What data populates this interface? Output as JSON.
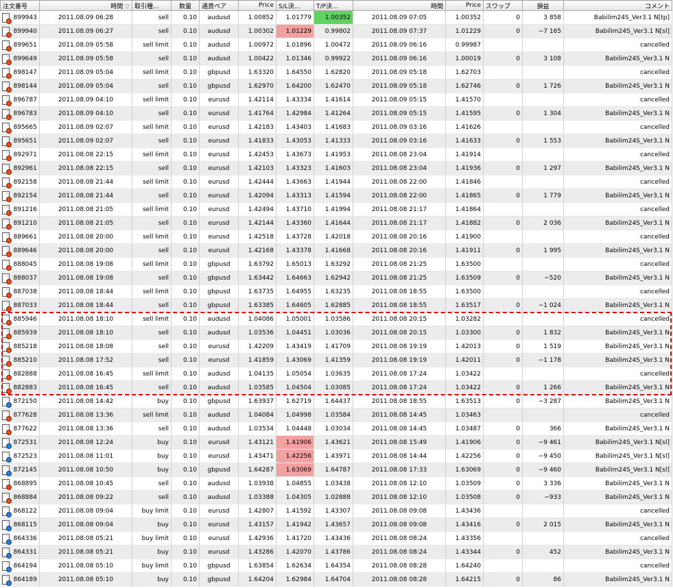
{
  "columns": [
    "注文番号",
    "時間",
    "取引種…",
    "数量",
    "通貨ペア",
    "Price",
    "S/L決…",
    "T/P決…",
    "時間",
    "Price",
    "スワップ",
    "損益",
    "コメント"
  ],
  "sort_icon": "sort-down-icon",
  "colors": {
    "sl_highlight": "#f2a0a0",
    "tp_highlight": "#5fd35f",
    "selection_border": "#e00000",
    "sell_icon": "#e8501c",
    "buy_icon": "#2a7fd9"
  },
  "rows": [
    {
      "id": "899943",
      "open": "2011.08.09 06:28",
      "type": "sell",
      "lots": "0.10",
      "pair": "audusd",
      "price": "1.00852",
      "sl": "1.01779",
      "tp": "1.00352",
      "close": "2011.08.09 07:05",
      "cprice": "1.00352",
      "swap": "0",
      "profit": "3 858",
      "comment": "Babilim24S_Ver3.1 N[tp]",
      "hl": "tp"
    },
    {
      "id": "899940",
      "open": "2011.08.09 06:27",
      "type": "sell",
      "lots": "0.10",
      "pair": "audusd",
      "price": "1.00302",
      "sl": "1.01229",
      "tp": "0.99802",
      "close": "2011.08.09 07:37",
      "cprice": "1.01229",
      "swap": "0",
      "profit": "−7 165",
      "comment": "Babilim24S_Ver3.1 N[sl]",
      "hl": "sl"
    },
    {
      "id": "899651",
      "open": "2011.08.09 05:58",
      "type": "sell limit",
      "lots": "0.10",
      "pair": "audusd",
      "price": "1.00972",
      "sl": "1.01896",
      "tp": "1.00472",
      "close": "2011.08.09 06:16",
      "cprice": "0.99987",
      "swap": "",
      "profit": "",
      "comment": "cancelled",
      "hl": ""
    },
    {
      "id": "899649",
      "open": "2011.08.09 05:58",
      "type": "sell",
      "lots": "0.10",
      "pair": "audusd",
      "price": "1.00422",
      "sl": "1.01346",
      "tp": "0.99922",
      "close": "2011.08.09 06:16",
      "cprice": "1.00019",
      "swap": "0",
      "profit": "3 108",
      "comment": "Babilim24S_Ver3.1 N",
      "hl": ""
    },
    {
      "id": "898147",
      "open": "2011.08.09 05:04",
      "type": "sell limit",
      "lots": "0.10",
      "pair": "gbpusd",
      "price": "1.63320",
      "sl": "1.64550",
      "tp": "1.62820",
      "close": "2011.08.09 05:18",
      "cprice": "1.62703",
      "swap": "",
      "profit": "",
      "comment": "cancelled",
      "hl": ""
    },
    {
      "id": "898144",
      "open": "2011.08.09 05:04",
      "type": "sell",
      "lots": "0.10",
      "pair": "gbpusd",
      "price": "1.62970",
      "sl": "1.64200",
      "tp": "1.62470",
      "close": "2011.08.09 05:18",
      "cprice": "1.62746",
      "swap": "0",
      "profit": "1 726",
      "comment": "Babilim24S_Ver3.1 N",
      "hl": ""
    },
    {
      "id": "896787",
      "open": "2011.08.09 04:10",
      "type": "sell limit",
      "lots": "0.10",
      "pair": "eurusd",
      "price": "1.42114",
      "sl": "1.43334",
      "tp": "1.41614",
      "close": "2011.08.09 05:15",
      "cprice": "1.41570",
      "swap": "",
      "profit": "",
      "comment": "cancelled",
      "hl": ""
    },
    {
      "id": "896783",
      "open": "2011.08.09 04:10",
      "type": "sell",
      "lots": "0.10",
      "pair": "eurusd",
      "price": "1.41764",
      "sl": "1.42984",
      "tp": "1.41264",
      "close": "2011.08.09 05:15",
      "cprice": "1.41595",
      "swap": "0",
      "profit": "1 304",
      "comment": "Babilim24S_Ver3.1 N",
      "hl": ""
    },
    {
      "id": "895665",
      "open": "2011.08.09 02:07",
      "type": "sell limit",
      "lots": "0.10",
      "pair": "eurusd",
      "price": "1.42183",
      "sl": "1.43403",
      "tp": "1.41683",
      "close": "2011.08.09 03:16",
      "cprice": "1.41626",
      "swap": "",
      "profit": "",
      "comment": "cancelled",
      "hl": ""
    },
    {
      "id": "895651",
      "open": "2011.08.09 02:07",
      "type": "sell",
      "lots": "0.10",
      "pair": "eurusd",
      "price": "1.41833",
      "sl": "1.43053",
      "tp": "1.41333",
      "close": "2011.08.09 03:16",
      "cprice": "1.41633",
      "swap": "0",
      "profit": "1 553",
      "comment": "Babilim24S_Ver3.1 N",
      "hl": ""
    },
    {
      "id": "892971",
      "open": "2011.08.08 22:15",
      "type": "sell limit",
      "lots": "0.10",
      "pair": "eurusd",
      "price": "1.42453",
      "sl": "1.43673",
      "tp": "1.41953",
      "close": "2011.08.08 23:04",
      "cprice": "1.41914",
      "swap": "",
      "profit": "",
      "comment": "cancelled",
      "hl": ""
    },
    {
      "id": "892961",
      "open": "2011.08.08 22:15",
      "type": "sell",
      "lots": "0.10",
      "pair": "eurusd",
      "price": "1.42103",
      "sl": "1.43323",
      "tp": "1.41603",
      "close": "2011.08.08 23:04",
      "cprice": "1.41936",
      "swap": "0",
      "profit": "1 297",
      "comment": "Babilim24S_Ver3.1 N",
      "hl": ""
    },
    {
      "id": "892158",
      "open": "2011.08.08 21:44",
      "type": "sell limit",
      "lots": "0.10",
      "pair": "eurusd",
      "price": "1.42444",
      "sl": "1.43663",
      "tp": "1.41944",
      "close": "2011.08.08 22:00",
      "cprice": "1.41846",
      "swap": "",
      "profit": "",
      "comment": "cancelled",
      "hl": ""
    },
    {
      "id": "892154",
      "open": "2011.08.08 21:44",
      "type": "sell",
      "lots": "0.10",
      "pair": "eurusd",
      "price": "1.42094",
      "sl": "1.43313",
      "tp": "1.41594",
      "close": "2011.08.08 22:00",
      "cprice": "1.41865",
      "swap": "0",
      "profit": "1 779",
      "comment": "Babilim24S_Ver3.1 N",
      "hl": ""
    },
    {
      "id": "891216",
      "open": "2011.08.08 21:05",
      "type": "sell limit",
      "lots": "0.10",
      "pair": "eurusd",
      "price": "1.42494",
      "sl": "1.43710",
      "tp": "1.41994",
      "close": "2011.08.08 21:17",
      "cprice": "1.41864",
      "swap": "",
      "profit": "",
      "comment": "cancelled",
      "hl": ""
    },
    {
      "id": "891210",
      "open": "2011.08.08 21:05",
      "type": "sell",
      "lots": "0.10",
      "pair": "eurusd",
      "price": "1.42144",
      "sl": "1.43360",
      "tp": "1.41644",
      "close": "2011.08.08 21:17",
      "cprice": "1.41882",
      "swap": "0",
      "profit": "2 036",
      "comment": "Babilim24S_Ver3.1 N",
      "hl": ""
    },
    {
      "id": "889661",
      "open": "2011.08.08 20:00",
      "type": "sell limit",
      "lots": "0.10",
      "pair": "eurusd",
      "price": "1.42518",
      "sl": "1.43728",
      "tp": "1.42018",
      "close": "2011.08.08 20:16",
      "cprice": "1.41900",
      "swap": "",
      "profit": "",
      "comment": "cancelled",
      "hl": ""
    },
    {
      "id": "889646",
      "open": "2011.08.08 20:00",
      "type": "sell",
      "lots": "0.10",
      "pair": "eurusd",
      "price": "1.42168",
      "sl": "1.43378",
      "tp": "1.41668",
      "close": "2011.08.08 20:16",
      "cprice": "1.41911",
      "swap": "0",
      "profit": "1 995",
      "comment": "Babilim24S_Ver3.1 N",
      "hl": ""
    },
    {
      "id": "888045",
      "open": "2011.08.08 19:08",
      "type": "sell limit",
      "lots": "0.10",
      "pair": "gbpusd",
      "price": "1.63792",
      "sl": "1.65013",
      "tp": "1.63292",
      "close": "2011.08.08 21:25",
      "cprice": "1.63500",
      "swap": "",
      "profit": "",
      "comment": "cancelled",
      "hl": ""
    },
    {
      "id": "888037",
      "open": "2011.08.08 19:08",
      "type": "sell",
      "lots": "0.10",
      "pair": "gbpusd",
      "price": "1.63442",
      "sl": "1.64663",
      "tp": "1.62942",
      "close": "2011.08.08 21:25",
      "cprice": "1.63509",
      "swap": "0",
      "profit": "−520",
      "comment": "Babilim24S_Ver3.1 N",
      "hl": ""
    },
    {
      "id": "887038",
      "open": "2011.08.08 18:44",
      "type": "sell limit",
      "lots": "0.10",
      "pair": "gbpusd",
      "price": "1.63735",
      "sl": "1.64955",
      "tp": "1.63235",
      "close": "2011.08.08 18:55",
      "cprice": "1.63500",
      "swap": "",
      "profit": "",
      "comment": "cancelled",
      "hl": ""
    },
    {
      "id": "887033",
      "open": "2011.08.08 18:44",
      "type": "sell",
      "lots": "0.10",
      "pair": "gbpusd",
      "price": "1.63385",
      "sl": "1.64605",
      "tp": "1.62885",
      "close": "2011.08.08 18:55",
      "cprice": "1.63517",
      "swap": "0",
      "profit": "−1 024",
      "comment": "Babilim24S_Ver3.1 N",
      "hl": ""
    },
    {
      "id": "885946",
      "open": "2011.08.08 18:10",
      "type": "sell limit",
      "lots": "0.10",
      "pair": "audusd",
      "price": "1.04086",
      "sl": "1.05001",
      "tp": "1.03586",
      "close": "2011.08.08 20:15",
      "cprice": "1.03282",
      "swap": "",
      "profit": "",
      "comment": "cancelled",
      "hl": ""
    },
    {
      "id": "885939",
      "open": "2011.08.08 18:10",
      "type": "sell",
      "lots": "0.10",
      "pair": "audusd",
      "price": "1.03536",
      "sl": "1.04451",
      "tp": "1.03036",
      "close": "2011.08.08 20:15",
      "cprice": "1.03300",
      "swap": "0",
      "profit": "1 832",
      "comment": "Babilim24S_Ver3.1 N",
      "hl": ""
    },
    {
      "id": "885218",
      "open": "2011.08.08 18:08",
      "type": "sell",
      "lots": "0.10",
      "pair": "eurusd",
      "price": "1.42209",
      "sl": "1.43419",
      "tp": "1.41709",
      "close": "2011.08.08 19:19",
      "cprice": "1.42013",
      "swap": "0",
      "profit": "1 519",
      "comment": "Babilim24S_Ver3.1 N",
      "hl": ""
    },
    {
      "id": "885210",
      "open": "2011.08.08 17:52",
      "type": "sell",
      "lots": "0.10",
      "pair": "eurusd",
      "price": "1.41859",
      "sl": "1.43069",
      "tp": "1.41359",
      "close": "2011.08.08 19:19",
      "cprice": "1.42011",
      "swap": "0",
      "profit": "−1 178",
      "comment": "Babilim24S_Ver3.1 N",
      "hl": ""
    },
    {
      "id": "882888",
      "open": "2011.08.08 16:45",
      "type": "sell limit",
      "lots": "0.10",
      "pair": "audusd",
      "price": "1.04135",
      "sl": "1.05054",
      "tp": "1.03635",
      "close": "2011.08.08 17:24",
      "cprice": "1.03422",
      "swap": "",
      "profit": "",
      "comment": "cancelled",
      "hl": ""
    },
    {
      "id": "882883",
      "open": "2011.08.08 16:45",
      "type": "sell",
      "lots": "0.10",
      "pair": "audusd",
      "price": "1.03585",
      "sl": "1.04504",
      "tp": "1.03085",
      "close": "2011.08.08 17:24",
      "cprice": "1.03422",
      "swap": "0",
      "profit": "1 266",
      "comment": "Babilim24S_Ver3.1 N",
      "hl": ""
    },
    {
      "id": "872150",
      "open": "2011.08.08 14:42",
      "type": "buy",
      "lots": "0.10",
      "pair": "gbpusd",
      "price": "1.63937",
      "sl": "1.62719",
      "tp": "1.64437",
      "close": "2011.08.08 18:55",
      "cprice": "1.63513",
      "swap": "0",
      "profit": "−3 287",
      "comment": "Babilim24S_Ver3.1 N",
      "hl": ""
    },
    {
      "id": "877628",
      "open": "2011.08.08 13:36",
      "type": "sell limit",
      "lots": "0.10",
      "pair": "audusd",
      "price": "1.04084",
      "sl": "1.04998",
      "tp": "1.03584",
      "close": "2011.08.08 14:45",
      "cprice": "1.03463",
      "swap": "",
      "profit": "",
      "comment": "cancelled",
      "hl": ""
    },
    {
      "id": "877622",
      "open": "2011.08.08 13:36",
      "type": "sell",
      "lots": "0.10",
      "pair": "audusd",
      "price": "1.03534",
      "sl": "1.04448",
      "tp": "1.03034",
      "close": "2011.08.08 14:45",
      "cprice": "1.03487",
      "swap": "0",
      "profit": "366",
      "comment": "Babilim24S_Ver3.1 N",
      "hl": ""
    },
    {
      "id": "872531",
      "open": "2011.08.08 12:24",
      "type": "buy",
      "lots": "0.10",
      "pair": "eurusd",
      "price": "1.43121",
      "sl": "1.41906",
      "tp": "1.43621",
      "close": "2011.08.08 15:49",
      "cprice": "1.41906",
      "swap": "0",
      "profit": "−9 461",
      "comment": "Babilim24S_Ver3.1 N[sl]",
      "hl": "sl"
    },
    {
      "id": "872523",
      "open": "2011.08.08 11:01",
      "type": "buy",
      "lots": "0.10",
      "pair": "eurusd",
      "price": "1.43471",
      "sl": "1.42256",
      "tp": "1.43971",
      "close": "2011.08.08 14:44",
      "cprice": "1.42256",
      "swap": "0",
      "profit": "−9 450",
      "comment": "Babilim24S_Ver3.1 N[sl]",
      "hl": "sl"
    },
    {
      "id": "872145",
      "open": "2011.08.08 10:50",
      "type": "buy",
      "lots": "0.10",
      "pair": "gbpusd",
      "price": "1.64287",
      "sl": "1.63069",
      "tp": "1.64787",
      "close": "2011.08.08 17:33",
      "cprice": "1.63069",
      "swap": "0",
      "profit": "−9 460",
      "comment": "Babilim24S_Ver3.1 N[sl]",
      "hl": "sl"
    },
    {
      "id": "868895",
      "open": "2011.08.08 10:45",
      "type": "sell",
      "lots": "0.10",
      "pair": "audusd",
      "price": "1.03938",
      "sl": "1.04855",
      "tp": "1.03438",
      "close": "2011.08.08 12:10",
      "cprice": "1.03509",
      "swap": "0",
      "profit": "3 336",
      "comment": "Babilim24S_Ver3.1 N",
      "hl": ""
    },
    {
      "id": "868884",
      "open": "2011.08.08 09:22",
      "type": "sell",
      "lots": "0.10",
      "pair": "audusd",
      "price": "1.03388",
      "sl": "1.04305",
      "tp": "1.02888",
      "close": "2011.08.08 12:10",
      "cprice": "1.03508",
      "swap": "0",
      "profit": "−933",
      "comment": "Babilim24S_Ver3.1 N",
      "hl": ""
    },
    {
      "id": "868122",
      "open": "2011.08.08 09:04",
      "type": "buy limit",
      "lots": "0.10",
      "pair": "eurusd",
      "price": "1.42807",
      "sl": "1.41592",
      "tp": "1.43307",
      "close": "2011.08.08 09:08",
      "cprice": "1.43436",
      "swap": "",
      "profit": "",
      "comment": "cancelled",
      "hl": ""
    },
    {
      "id": "868115",
      "open": "2011.08.08 09:04",
      "type": "buy",
      "lots": "0.10",
      "pair": "eurusd",
      "price": "1.43157",
      "sl": "1.41942",
      "tp": "1.43657",
      "close": "2011.08.08 09:08",
      "cprice": "1.43416",
      "swap": "0",
      "profit": "2 015",
      "comment": "Babilim24S_Ver3.1 N",
      "hl": ""
    },
    {
      "id": "864336",
      "open": "2011.08.08 05:21",
      "type": "buy limit",
      "lots": "0.10",
      "pair": "eurusd",
      "price": "1.42936",
      "sl": "1.41720",
      "tp": "1.43436",
      "close": "2011.08.08 08:24",
      "cprice": "1.43356",
      "swap": "",
      "profit": "",
      "comment": "cancelled",
      "hl": ""
    },
    {
      "id": "864331",
      "open": "2011.08.08 05:21",
      "type": "buy",
      "lots": "0.10",
      "pair": "eurusd",
      "price": "1.43286",
      "sl": "1.42070",
      "tp": "1.43786",
      "close": "2011.08.08 08:24",
      "cprice": "1.43344",
      "swap": "0",
      "profit": "452",
      "comment": "Babilim24S_Ver3.1 N",
      "hl": ""
    },
    {
      "id": "864194",
      "open": "2011.08.08 05:10",
      "type": "buy limit",
      "lots": "0.10",
      "pair": "gbpusd",
      "price": "1.63854",
      "sl": "1.62634",
      "tp": "1.64354",
      "close": "2011.08.08 08:28",
      "cprice": "1.64240",
      "swap": "",
      "profit": "",
      "comment": "cancelled",
      "hl": ""
    },
    {
      "id": "864189",
      "open": "2011.08.08 05:10",
      "type": "buy",
      "lots": "0.10",
      "pair": "gbpusd",
      "price": "1.64204",
      "sl": "1.62984",
      "tp": "1.64704",
      "close": "2011.08.08 08:28",
      "cprice": "1.64215",
      "swap": "0",
      "profit": "86",
      "comment": "Babilim24S_Ver3.1 N",
      "hl": ""
    }
  ]
}
